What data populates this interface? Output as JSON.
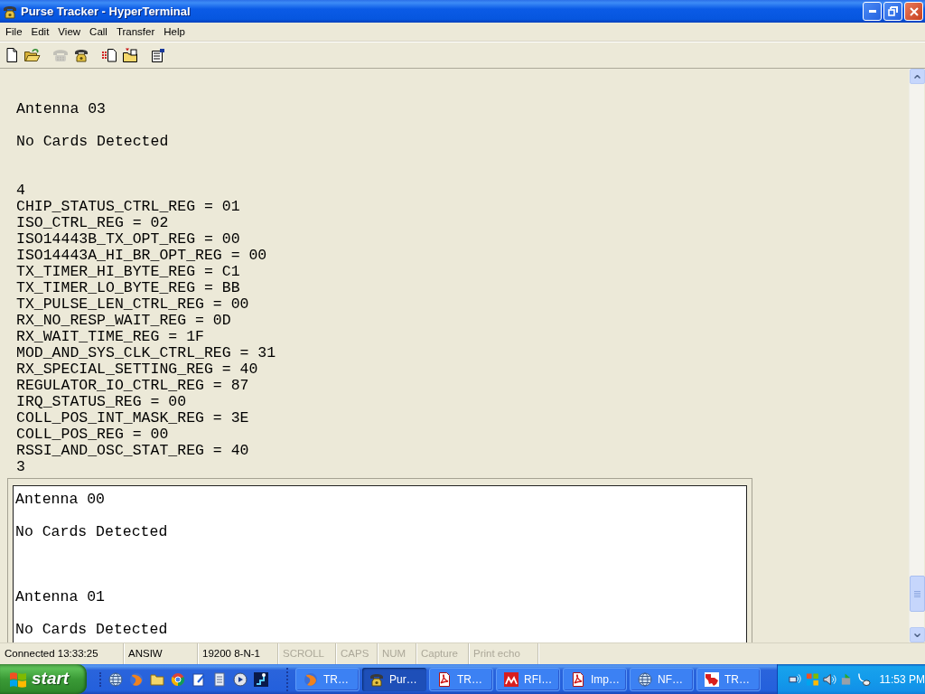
{
  "window": {
    "title": "Purse Tracker - HyperTerminal"
  },
  "menu": [
    "File",
    "Edit",
    "View",
    "Call",
    "Transfer",
    "Help"
  ],
  "toolbar": [
    [
      {
        "kind": "new",
        "disabled": false
      },
      {
        "kind": "open",
        "disabled": false
      }
    ],
    [
      {
        "kind": "call",
        "disabled": true
      },
      {
        "kind": "disconnect",
        "disabled": false
      }
    ],
    [
      {
        "kind": "send",
        "disabled": false
      },
      {
        "kind": "receive",
        "disabled": false
      }
    ],
    [
      {
        "kind": "properties",
        "disabled": false
      }
    ]
  ],
  "scrollback": {
    "lines": [
      {
        "kind": "blank"
      },
      {
        "kind": "blank"
      },
      {
        "kind": "text",
        "text": "Antenna 03"
      },
      {
        "kind": "blank"
      },
      {
        "kind": "text",
        "text": "No Cards Detected"
      },
      {
        "kind": "blank"
      },
      {
        "kind": "blank"
      },
      {
        "kind": "text",
        "text": "4"
      },
      {
        "kind": "text",
        "text": "CHIP_STATUS_CTRL_REG = 01"
      },
      {
        "kind": "text",
        "text": "ISO_CTRL_REG = 02"
      },
      {
        "kind": "text",
        "text": "ISO14443B_TX_OPT_REG = 00"
      },
      {
        "kind": "text",
        "text": "ISO14443A_HI_BR_OPT_REG = 00"
      },
      {
        "kind": "text",
        "text": "TX_TIMER_HI_BYTE_REG = C1"
      },
      {
        "kind": "text",
        "text": "TX_TIMER_LO_BYTE_REG = BB"
      },
      {
        "kind": "text",
        "text": "TX_PULSE_LEN_CTRL_REG = 00"
      },
      {
        "kind": "text",
        "text": "RX_NO_RESP_WAIT_REG = 0D"
      },
      {
        "kind": "text",
        "text": "RX_WAIT_TIME_REG = 1F"
      },
      {
        "kind": "text",
        "text": "MOD_AND_SYS_CLK_CTRL_REG = 31"
      },
      {
        "kind": "text",
        "text": "RX_SPECIAL_SETTING_REG = 40"
      },
      {
        "kind": "text",
        "text": "REGULATOR_IO_CTRL_REG = 87"
      },
      {
        "kind": "text",
        "text": "IRQ_STATUS_REG = 00"
      },
      {
        "kind": "text",
        "text": "COLL_POS_INT_MASK_REG = 3E"
      },
      {
        "kind": "text",
        "text": "COLL_POS_REG = 00"
      },
      {
        "kind": "text",
        "text": "RSSI_AND_OSC_STAT_REG = 40"
      },
      {
        "kind": "text",
        "text": "3"
      }
    ]
  },
  "screen": {
    "lines": [
      {
        "kind": "text",
        "text": "Antenna 00"
      },
      {
        "kind": "blank"
      },
      {
        "kind": "text",
        "text": "No Cards Detected"
      },
      {
        "kind": "blank"
      },
      {
        "kind": "blank"
      },
      {
        "kind": "blank"
      },
      {
        "kind": "text",
        "text": "Antenna 01"
      },
      {
        "kind": "blank"
      },
      {
        "kind": "text",
        "text": "No Cards Detected"
      }
    ]
  },
  "status_bar": [
    {
      "text": "Connected 13:33:25",
      "active": true
    },
    {
      "text": "ANSIW",
      "active": true
    },
    {
      "text": "19200 8-N-1",
      "active": true
    },
    {
      "text": "SCROLL",
      "active": false
    },
    {
      "text": "CAPS",
      "active": false
    },
    {
      "text": "NUM",
      "active": false
    },
    {
      "text": "Capture",
      "active": false
    },
    {
      "text": "Print echo",
      "active": false
    }
  ],
  "taskbar": {
    "start": "start",
    "tasks": [
      {
        "kind": "browser",
        "label": "TR…",
        "selected": false
      },
      {
        "kind": "terminal",
        "label": "Pur…",
        "selected": true
      },
      {
        "kind": "pdf",
        "label": "TR…",
        "selected": false
      },
      {
        "kind": "chip",
        "label": "RFI…",
        "selected": false
      },
      {
        "kind": "pdf",
        "label": "Imp…",
        "selected": false
      },
      {
        "kind": "globe",
        "label": "NF…",
        "selected": false
      },
      {
        "kind": "map",
        "label": "TR…",
        "selected": false
      }
    ],
    "clock": "11:53 PM"
  }
}
